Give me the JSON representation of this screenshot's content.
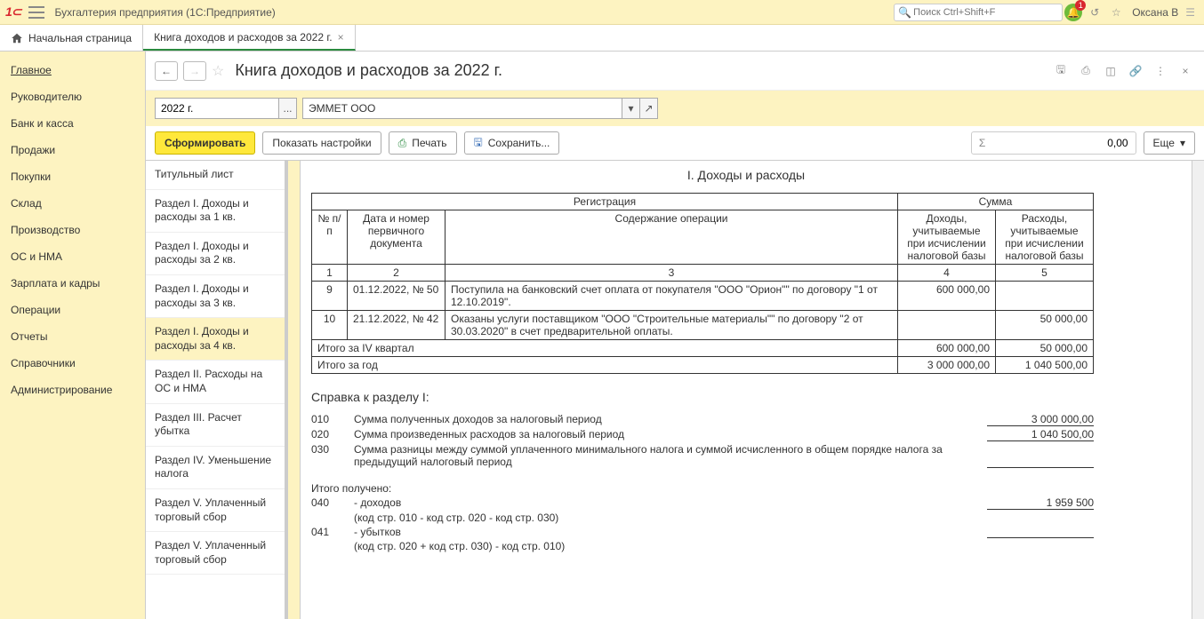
{
  "app": {
    "title": "Бухгалтерия предприятия  (1С:Предприятие)",
    "search_placeholder": "Поиск Ctrl+Shift+F",
    "user": "Оксана В",
    "notif_count": "1"
  },
  "tabs": {
    "home": "Начальная страница",
    "active": "Книга доходов и расходов за 2022 г."
  },
  "sidebar": [
    "Главное",
    "Руководителю",
    "Банк и касса",
    "Продажи",
    "Покупки",
    "Склад",
    "Производство",
    "ОС и НМА",
    "Зарплата и кадры",
    "Операции",
    "Отчеты",
    "Справочники",
    "Администрирование"
  ],
  "page": {
    "title": "Книга доходов и расходов за 2022 г.",
    "period": "2022 г.",
    "org": "ЭММЕТ ООО",
    "btn_form": "Сформировать",
    "btn_settings": "Показать настройки",
    "btn_print": "Печать",
    "btn_save": "Сохранить...",
    "btn_more": "Еще",
    "sigma_value": "0,00"
  },
  "navlist": [
    "Титульный лист",
    "Раздел I. Доходы и расходы за 1 кв.",
    "Раздел I. Доходы и расходы за 2 кв.",
    "Раздел I. Доходы и расходы за 3 кв.",
    "Раздел I. Доходы и расходы за 4 кв.",
    "Раздел II. Расходы на ОС и НМА",
    "Раздел III. Расчет убытка",
    "Раздел IV. Уменьшение налога",
    "Раздел V. Уплаченный торговый сбор",
    "Раздел V. Уплаченный торговый сбор"
  ],
  "report": {
    "section_title": "I. Доходы и расходы",
    "head_reg": "Регистрация",
    "head_sum": "Сумма",
    "col_np": "№ п/п",
    "col_doc": "Дата и номер первичного документа",
    "col_op": "Содержание операции",
    "col_income": "Доходы, учитываемые при исчислении налоговой базы",
    "col_expense": "Расходы, учитываемые при исчислении налоговой базы",
    "colnums": [
      "1",
      "2",
      "3",
      "4",
      "5"
    ],
    "rows": [
      {
        "n": "9",
        "doc": "01.12.2022, № 50",
        "op": "Поступила на банковский счет оплата от покупателя \"ООО \"Орион\"\" по договору \"1 от 12.10.2019\".",
        "inc": "600 000,00",
        "exp": ""
      },
      {
        "n": "10",
        "doc": "21.12.2022, № 42",
        "op": "Оказаны услуги поставщиком \"ООО \"Строительные материалы\"\" по договору \"2 от 30.03.2020\" в счет предварительной оплаты.",
        "inc": "",
        "exp": "50 000,00"
      }
    ],
    "totals": [
      {
        "label": "Итого за IV квартал",
        "inc": "600 000,00",
        "exp": "50 000,00"
      },
      {
        "label": "Итого за год",
        "inc": "3 000 000,00",
        "exp": "1 040 500,00"
      }
    ],
    "ref_title": "Справка к разделу I:",
    "ref_rows": [
      {
        "code": "010",
        "text": "Сумма полученных доходов за налоговый период",
        "val": "3 000 000,00"
      },
      {
        "code": "020",
        "text": "Сумма произведенных  расходов за налоговый период",
        "val": "1 040 500,00"
      },
      {
        "code": "030",
        "text": "Сумма разницы между  суммой уплаченного минимального налога и суммой исчисленного в общем порядке налога за предыдущий налоговый период",
        "val": ""
      }
    ],
    "got_label": "Итого получено:",
    "got_rows": [
      {
        "code": "040",
        "text": "- доходов",
        "sub": "(код стр. 010 - код  стр. 020 - код стр. 030)",
        "val": "1 959 500"
      },
      {
        "code": "041",
        "text": "- убытков",
        "sub": "(код стр. 020 + код  стр. 030) - код стр. 010)",
        "val": ""
      }
    ]
  }
}
